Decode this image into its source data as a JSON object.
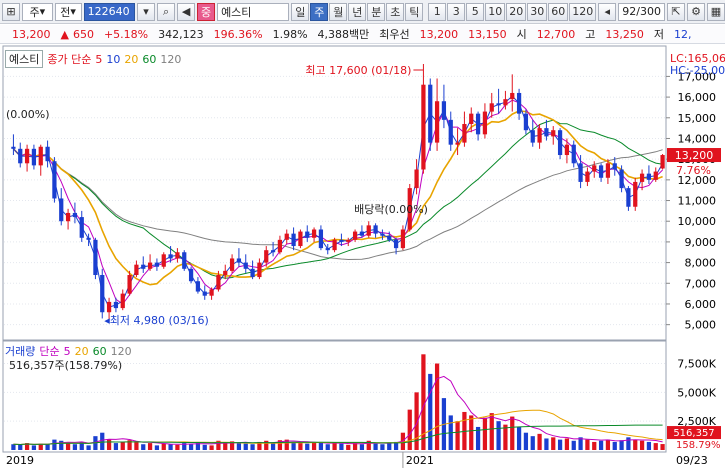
{
  "toolbar": {
    "mode1": "주",
    "mode2": "전",
    "code": "122640",
    "badge": "중",
    "stock_name": "예스티",
    "periods": [
      "일",
      "주",
      "월",
      "년",
      "분",
      "초",
      "틱"
    ],
    "active_period": 1,
    "nums": [
      "1",
      "3",
      "5",
      "10",
      "20",
      "30",
      "60",
      "120"
    ],
    "count": "92/300"
  },
  "info": {
    "price": "13,200",
    "change": "650",
    "change_pct": "+5.18%",
    "volume": "342,123",
    "vol_ratio": "196.36%",
    "turnover": "1.98%",
    "amount": "4,388백만",
    "best": "최우선",
    "ask": "13,200",
    "bid": "13,150",
    "open_label": "시",
    "open": "12,700",
    "high_label": "고",
    "high": "13,250",
    "low_label": "저",
    "low": "12,"
  },
  "legend": {
    "name": "예스티",
    "ma_label": "종가 단순",
    "ma5": "5",
    "ma10": "10",
    "ma20": "20",
    "ma60": "60",
    "ma120": "120"
  },
  "vol_legend": {
    "name": "거래량",
    "ma_label": "단순",
    "ma5": "5",
    "ma20": "20",
    "ma60": "60",
    "ma120": "120",
    "current": "516,357주(158.79%)"
  },
  "annotations": {
    "high": "최고 17,600 (01/18)",
    "low": "최저 4,980 (03/16)",
    "dividend": "배당락(0.00%)",
    "start_pct": "(0.00%)"
  },
  "right_axis": {
    "lc": "LC:165,06",
    "hc": "HC:-25,00",
    "current_price": "13,200",
    "current_pct": "7.76%",
    "ticks": [
      "17,000",
      "16,000",
      "15,000",
      "14,000",
      "13,000",
      "12,000",
      "11,000",
      "10,000",
      "9,000",
      "8,000",
      "7,000",
      "6,000",
      "5,000"
    ],
    "vol_ticks": [
      "7,500K",
      "5,000K",
      "2,500K"
    ],
    "vol_current": "516,357",
    "vol_pct": "158.79%"
  },
  "x_axis": {
    "labels": [
      "2019",
      "2021"
    ],
    "end_date": "09/23"
  },
  "colors": {
    "up": "#e0131e",
    "down": "#1a3fd0",
    "ma5": "#1a3fd0",
    "ma10": "#c000c0",
    "ma20": "#e8a400",
    "ma60": "#0a8a2a",
    "ma120": "#808080"
  },
  "chart_data": {
    "type": "candlestick",
    "price_range": [
      4500,
      17600
    ],
    "candles": [
      [
        13600,
        14200,
        13200,
        13500
      ],
      [
        13500,
        13800,
        12600,
        12800
      ],
      [
        12800,
        13700,
        12400,
        13500
      ],
      [
        13500,
        13700,
        12500,
        12700
      ],
      [
        12700,
        13700,
        12200,
        13600
      ],
      [
        13600,
        13900,
        12600,
        12900
      ],
      [
        12900,
        13100,
        10900,
        11100
      ],
      [
        11100,
        11600,
        9800,
        10000
      ],
      [
        10000,
        10600,
        9600,
        10400
      ],
      [
        10400,
        10900,
        9900,
        10200
      ],
      [
        10200,
        10500,
        9000,
        9200
      ],
      [
        9200,
        9400,
        8800,
        9100
      ],
      [
        9100,
        9200,
        7200,
        7400
      ],
      [
        7400,
        7700,
        5300,
        5600
      ],
      [
        5600,
        6300,
        5200,
        6100
      ],
      [
        6100,
        6300,
        5600,
        5800
      ],
      [
        5800,
        6700,
        5700,
        6500
      ],
      [
        6500,
        7600,
        6400,
        7400
      ],
      [
        7400,
        8100,
        7300,
        7900
      ],
      [
        7900,
        8300,
        7500,
        7700
      ],
      [
        7700,
        8400,
        7600,
        8000
      ],
      [
        8000,
        8200,
        7600,
        7800
      ],
      [
        7800,
        8500,
        7700,
        8400
      ],
      [
        8400,
        8800,
        8000,
        8200
      ],
      [
        8200,
        8700,
        8000,
        8500
      ],
      [
        8500,
        8600,
        7600,
        7700
      ],
      [
        7700,
        7800,
        7000,
        7100
      ],
      [
        7100,
        7300,
        6500,
        6600
      ],
      [
        6600,
        6900,
        6200,
        6400
      ],
      [
        6400,
        6800,
        6200,
        6700
      ],
      [
        6700,
        7600,
        6600,
        7400
      ],
      [
        7400,
        7900,
        7200,
        7600
      ],
      [
        7600,
        8400,
        7500,
        8200
      ],
      [
        8200,
        8700,
        7800,
        8000
      ],
      [
        8000,
        8400,
        7500,
        7700
      ],
      [
        7700,
        8100,
        7200,
        7300
      ],
      [
        7300,
        8200,
        7200,
        8000
      ],
      [
        8000,
        8800,
        7800,
        8600
      ],
      [
        8600,
        9000,
        8300,
        8500
      ],
      [
        8500,
        9300,
        8400,
        9100
      ],
      [
        9100,
        9600,
        8900,
        9400
      ],
      [
        9400,
        9700,
        8600,
        8800
      ],
      [
        8800,
        9600,
        8700,
        9500
      ],
      [
        9500,
        9800,
        9000,
        9200
      ],
      [
        9200,
        9700,
        9000,
        9600
      ],
      [
        9600,
        9800,
        8600,
        8700
      ],
      [
        8700,
        8900,
        8400,
        8600
      ],
      [
        8600,
        9200,
        8500,
        9100
      ],
      [
        9100,
        9400,
        8800,
        9000
      ],
      [
        9000,
        9200,
        8800,
        9100
      ],
      [
        9100,
        9600,
        9000,
        9500
      ],
      [
        9500,
        9800,
        9200,
        9300
      ],
      [
        9300,
        10000,
        9200,
        9800
      ],
      [
        9800,
        9900,
        9200,
        9400
      ],
      [
        9400,
        9600,
        9100,
        9300
      ],
      [
        9300,
        9500,
        9000,
        9100
      ],
      [
        9100,
        9200,
        8400,
        8700
      ],
      [
        8700,
        9800,
        8600,
        9600
      ],
      [
        9600,
        11800,
        9500,
        11600
      ],
      [
        11600,
        13000,
        11300,
        12500
      ],
      [
        12500,
        17600,
        12300,
        16600
      ],
      [
        16600,
        16900,
        13400,
        13800
      ],
      [
        13800,
        16900,
        13400,
        15800
      ],
      [
        15800,
        16600,
        14500,
        14900
      ],
      [
        14900,
        15300,
        13400,
        13700
      ],
      [
        13700,
        14500,
        13200,
        13800
      ],
      [
        13800,
        15300,
        13600,
        14700
      ],
      [
        14700,
        15500,
        14300,
        15200
      ],
      [
        15200,
        15300,
        13900,
        14200
      ],
      [
        14200,
        15700,
        14000,
        15300
      ],
      [
        15300,
        16200,
        15000,
        15700
      ],
      [
        15700,
        16400,
        15200,
        15600
      ],
      [
        15600,
        16300,
        15400,
        15900
      ],
      [
        15900,
        17100,
        15300,
        16200
      ],
      [
        16200,
        16400,
        14900,
        15200
      ],
      [
        15200,
        15400,
        14200,
        14400
      ],
      [
        14400,
        14900,
        13600,
        13800
      ],
      [
        13800,
        14700,
        13500,
        14500
      ],
      [
        14500,
        14900,
        13900,
        14100
      ],
      [
        14100,
        14600,
        13700,
        14400
      ],
      [
        14400,
        14500,
        13000,
        13200
      ],
      [
        13200,
        14000,
        12800,
        13700
      ],
      [
        13700,
        13900,
        12600,
        12800
      ],
      [
        12800,
        13200,
        11600,
        11900
      ],
      [
        11900,
        12600,
        11700,
        12400
      ],
      [
        12400,
        12900,
        12100,
        12700
      ],
      [
        12700,
        12800,
        11900,
        12100
      ],
      [
        12100,
        13000,
        11800,
        12800
      ],
      [
        12800,
        13100,
        12200,
        12500
      ],
      [
        12500,
        12700,
        11400,
        11600
      ],
      [
        11600,
        11700,
        10500,
        10700
      ],
      [
        10700,
        12100,
        10500,
        11900
      ],
      [
        11900,
        12500,
        11500,
        12300
      ],
      [
        12300,
        12700,
        11800,
        12000
      ],
      [
        12000,
        12600,
        11900,
        12400
      ],
      [
        12550,
        13250,
        12500,
        13200
      ]
    ],
    "volumes": [
      500,
      450,
      600,
      400,
      550,
      500,
      900,
      800,
      600,
      500,
      700,
      400,
      1200,
      1500,
      900,
      600,
      700,
      850,
      750,
      500,
      600,
      400,
      550,
      500,
      450,
      600,
      500,
      700,
      450,
      400,
      800,
      650,
      750,
      600,
      550,
      500,
      700,
      800,
      650,
      850,
      900,
      700,
      600,
      550,
      650,
      700,
      500,
      600,
      550,
      450,
      650,
      500,
      800,
      550,
      500,
      600,
      700,
      1500,
      3500,
      5000,
      8300,
      6600,
      7500,
      4500,
      3000,
      2500,
      3300,
      3000,
      2000,
      2800,
      3200,
      2500,
      2200,
      2900,
      2000,
      1500,
      1200,
      1400,
      1000,
      1100,
      900,
      1000,
      800,
      1100,
      900,
      700,
      800,
      900,
      700,
      850,
      1100,
      900,
      800,
      700,
      600,
      516
    ],
    "vol_range": [
      0,
      8500
    ]
  }
}
